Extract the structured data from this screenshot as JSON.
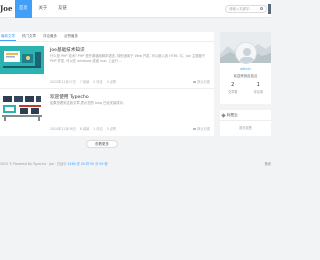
{
  "header": {
    "logo": "Joe",
    "nav": [
      {
        "label": "首页",
        "active": true
      },
      {
        "label": "关于",
        "active": false
      },
      {
        "label": "友链",
        "active": false
      }
    ],
    "search_placeholder": "请输入关键字..."
  },
  "tabs": [
    {
      "label": "最新文章",
      "active": true
    },
    {
      "label": "热门文章",
      "active": false
    },
    {
      "label": "评论最多",
      "active": false
    },
    {
      "label": "点赞最多",
      "active": false
    }
  ],
  "posts": [
    {
      "title": "Joe基础技术知识",
      "summary": "什么是 PHP 技术? PHP 是开源通用脚本语言, 特别适用于 Web 开发, 可以嵌入到 HTML 中。Joe 主题基于 PHP 开发, 可以在 windows 或者 mac 上运行 ...",
      "date": "2020年12月07日",
      "views": "7 阅读",
      "comments": "0 评论",
      "likes": "0 点赞",
      "category": "默认分类"
    },
    {
      "title": "欢迎使用 Typecho",
      "summary": "如果您看到这篇文章,表示您的 blog 已经安装成功.",
      "date": "2020年12月06日",
      "views": "8 阅读",
      "comments": "1 评论",
      "likes": "0 点赞",
      "category": "默认分类"
    }
  ],
  "load_more": "查看更多",
  "profile": {
    "name": "admin",
    "description": "欢迎来到此站点",
    "stats": [
      {
        "value": "2",
        "label": "文章数"
      },
      {
        "value": "1",
        "label": "评论量"
      }
    ]
  },
  "tags": {
    "header": "标签云",
    "empty_text": "暂无标签"
  },
  "footer": {
    "text": "2020 © Powered By Typecho · Joe · 已运行",
    "runtime": "1460 天 00 时 00 分 00 秒",
    "right": "备案"
  },
  "colors": {
    "accent": "#419ef9",
    "background": "#f1f3f5"
  }
}
